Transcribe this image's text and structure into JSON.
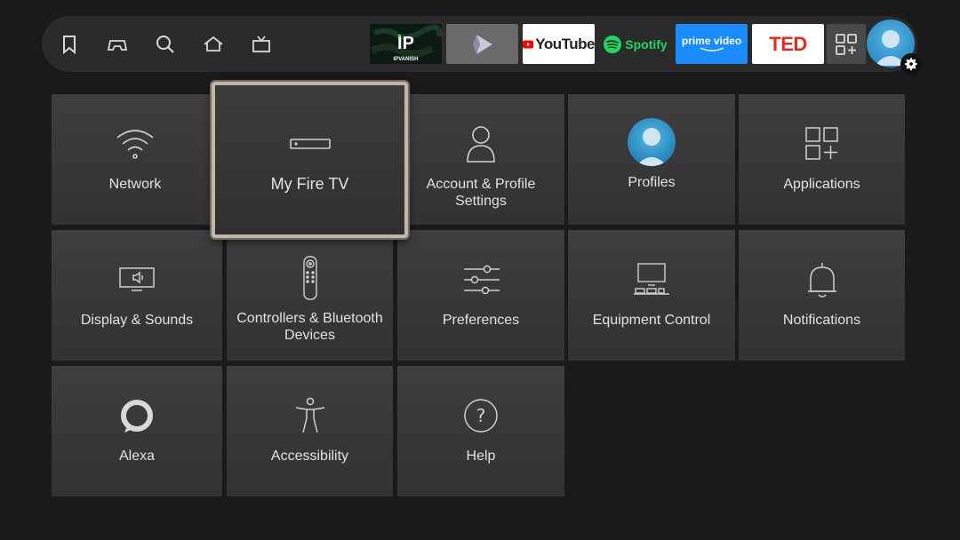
{
  "top_nav": {
    "icons": [
      {
        "name": "bookmark-icon"
      },
      {
        "name": "gamepad-icon"
      },
      {
        "name": "search-icon"
      },
      {
        "name": "home-icon"
      },
      {
        "name": "live-tv-icon"
      }
    ]
  },
  "apps": [
    {
      "name": "ipvanish",
      "label": "IPVANISH",
      "logo_text": "IP",
      "bg": "#0b1a12"
    },
    {
      "name": "plex-like",
      "label": "",
      "bg": "#6a6a6a"
    },
    {
      "name": "youtube",
      "label": "YouTube",
      "bg": "#ffffff"
    },
    {
      "name": "spotify",
      "label": "Spotify",
      "bg": "#2b2b2b"
    },
    {
      "name": "prime-video",
      "label": "prime video",
      "bg": "#1a8cff"
    },
    {
      "name": "ted",
      "label": "TED",
      "bg": "#ffffff"
    }
  ],
  "settings_tiles": [
    {
      "name": "network",
      "label": "Network"
    },
    {
      "name": "my-fire-tv",
      "label": "My Fire TV"
    },
    {
      "name": "account-profile-settings",
      "label": "Account & Profile Settings"
    },
    {
      "name": "profiles",
      "label": "Profiles"
    },
    {
      "name": "applications",
      "label": "Applications"
    },
    {
      "name": "display-sounds",
      "label": "Display & Sounds"
    },
    {
      "name": "controllers-bluetooth",
      "label": "Controllers & Bluetooth Devices"
    },
    {
      "name": "preferences",
      "label": "Preferences"
    },
    {
      "name": "equipment-control",
      "label": "Equipment Control"
    },
    {
      "name": "notifications",
      "label": "Notifications"
    },
    {
      "name": "alexa",
      "label": "Alexa"
    },
    {
      "name": "accessibility",
      "label": "Accessibility"
    },
    {
      "name": "help",
      "label": "Help"
    }
  ],
  "colors": {
    "background": "#1a1a1a",
    "topbar": "#2b2b2b",
    "tile": "#383838",
    "focus_border": "#bfb8a8",
    "youtube_red": "#ff0000",
    "spotify_green": "#1ed760",
    "ted_red": "#e62b1e",
    "prime_blue": "#1a8cff"
  }
}
